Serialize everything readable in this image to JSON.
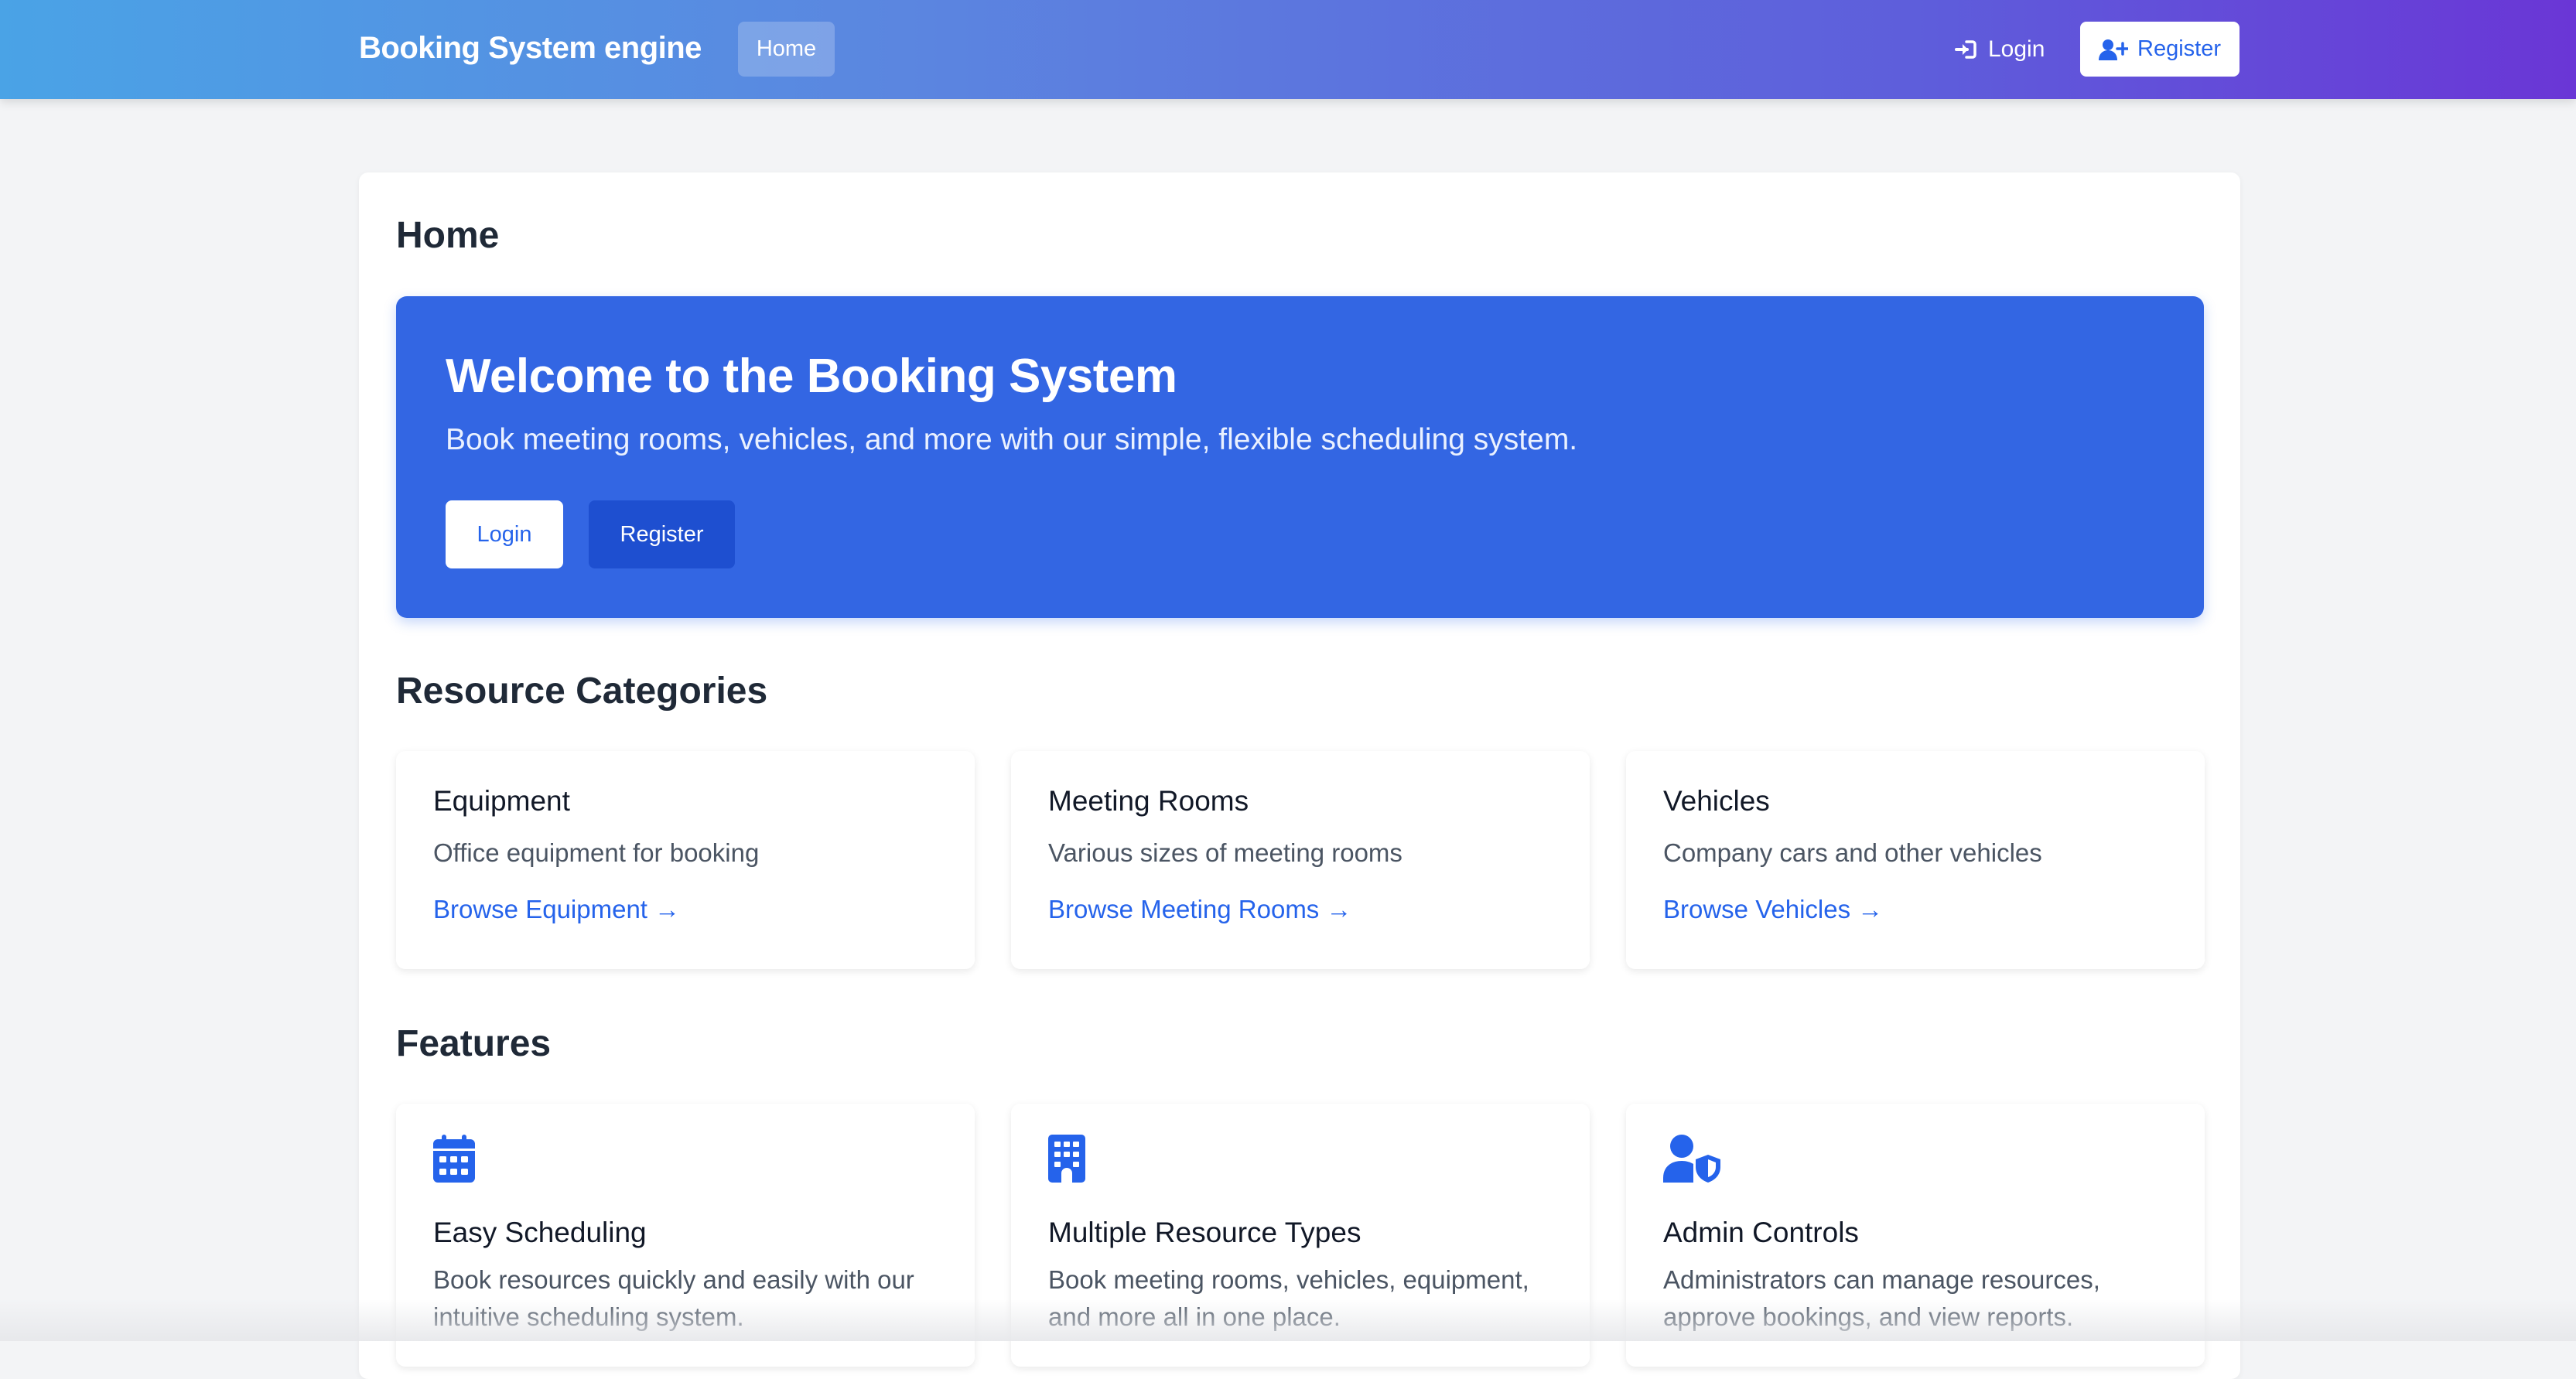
{
  "navbar": {
    "brand": "Booking System engine",
    "home_label": "Home",
    "login_label": "Login",
    "register_label": "Register",
    "login_icon": "sign-in-icon",
    "register_icon": "user-plus-icon"
  },
  "page": {
    "title": "Home"
  },
  "hero": {
    "title": "Welcome to the Booking System",
    "subtitle": "Book meeting rooms, vehicles, and more with our simple, flexible scheduling system.",
    "login_label": "Login",
    "register_label": "Register"
  },
  "categories": {
    "heading": "Resource Categories",
    "items": [
      {
        "title": "Equipment",
        "description": "Office equipment for booking",
        "link": "Browse Equipment →"
      },
      {
        "title": "Meeting Rooms",
        "description": "Various sizes of meeting rooms",
        "link": "Browse Meeting Rooms →"
      },
      {
        "title": "Vehicles",
        "description": "Company cars and other vehicles",
        "link": "Browse Vehicles →"
      }
    ]
  },
  "features": {
    "heading": "Features",
    "items": [
      {
        "icon": "calendar-icon",
        "title": "Easy Scheduling",
        "description": "Book resources quickly and easily with our intuitive scheduling system."
      },
      {
        "icon": "building-icon",
        "title": "Multiple Resource Types",
        "description": "Book meeting rooms, vehicles, equipment, and more all in one place."
      },
      {
        "icon": "user-shield-icon",
        "title": "Admin Controls",
        "description": "Administrators can manage resources, approve bookings, and view reports."
      }
    ]
  },
  "colors": {
    "accent": "#2563eb",
    "hero_bg": "#3366e3",
    "page_bg": "#f3f4f6"
  }
}
